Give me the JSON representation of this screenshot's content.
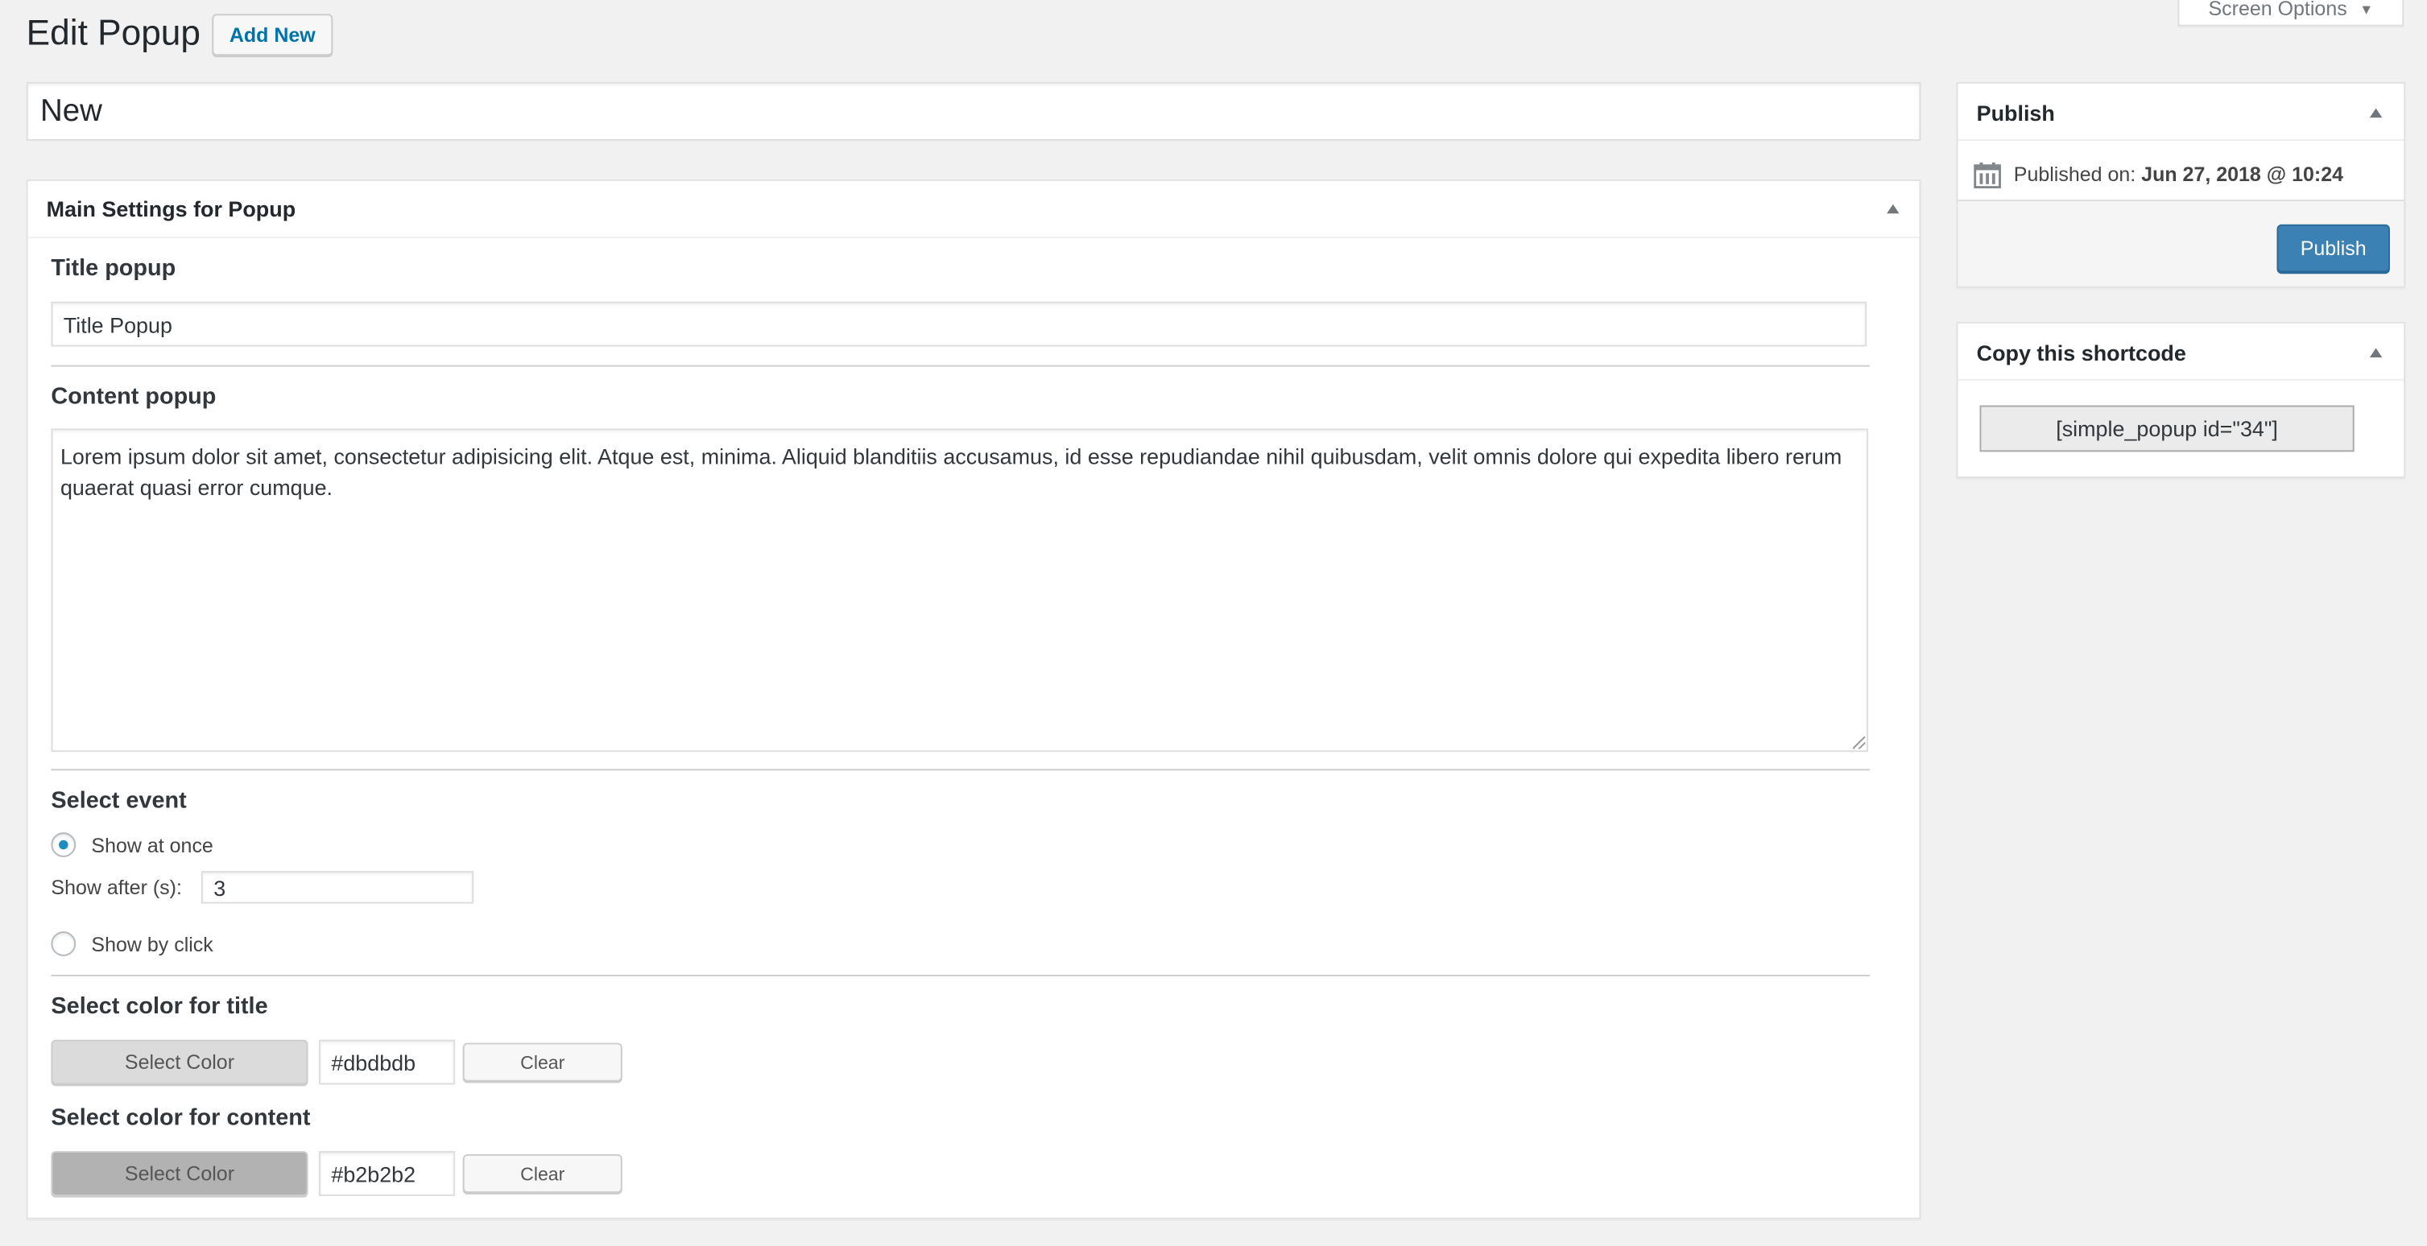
{
  "header": {
    "title": "Edit Popup",
    "add_new": "Add New",
    "screen_options": "Screen Options"
  },
  "post_title": "New",
  "main_box": {
    "title": "Main Settings for Popup",
    "title_label": "Title popup",
    "title_value": "Title Popup",
    "content_label": "Content popup",
    "content_value": "Lorem ipsum dolor sit amet, consectetur adipisicing elit. Atque est, minima. Aliquid blanditiis accusamus, id esse repudiandae nihil quibusdam, velit omnis dolore qui expedita libero rerum quaerat quasi error cumque.",
    "event_label": "Select event",
    "event_options": [
      {
        "label": "Show at once",
        "checked": true
      },
      {
        "label": "Show by click",
        "checked": false
      }
    ],
    "show_after_label": "Show after (s):",
    "show_after_value": "3",
    "title_color_label": "Select color for title",
    "title_color_value": "#dbdbdb",
    "content_color_label": "Select color for content",
    "content_color_value": "#b2b2b2",
    "select_color": "Select Color",
    "clear": "Clear"
  },
  "publish_box": {
    "title": "Publish",
    "published_on_label": "Published on:",
    "published_on_value": "Jun 27, 2018 @ 10:24",
    "publish_button": "Publish",
    "accent": "#0085ba"
  },
  "shortcode_box": {
    "title": "Copy this shortcode",
    "shortcode": "[simple_popup id=\"34\"]"
  }
}
